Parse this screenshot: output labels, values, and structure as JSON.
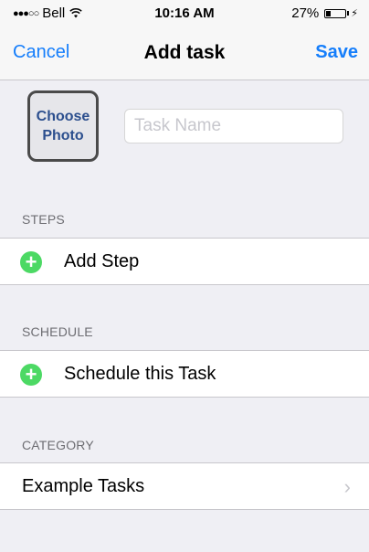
{
  "status_bar": {
    "signal": "●●●○○",
    "carrier": "Bell",
    "wifi_icon": "wifi-icon",
    "time": "10:16 AM",
    "battery_percent": "27%",
    "battery_level": 0.27
  },
  "nav": {
    "cancel_label": "Cancel",
    "title": "Add task",
    "save_label": "Save"
  },
  "task": {
    "choose_photo_line1": "Choose",
    "choose_photo_line2": "Photo",
    "name_placeholder": "Task Name",
    "name_value": ""
  },
  "sections": {
    "steps": {
      "header": "STEPS",
      "add_label": "Add Step",
      "icon": "plus-circle-icon"
    },
    "schedule": {
      "header": "SCHEDULE",
      "add_label": "Schedule this Task",
      "icon": "plus-circle-icon"
    },
    "category": {
      "header": "CATEGORY",
      "value": "Example Tasks",
      "icon": "chevron-right-icon"
    }
  },
  "colors": {
    "accent": "#157efb",
    "add_green": "#4cd964",
    "background": "#efeff4",
    "photo_text": "#2c4f8e"
  }
}
